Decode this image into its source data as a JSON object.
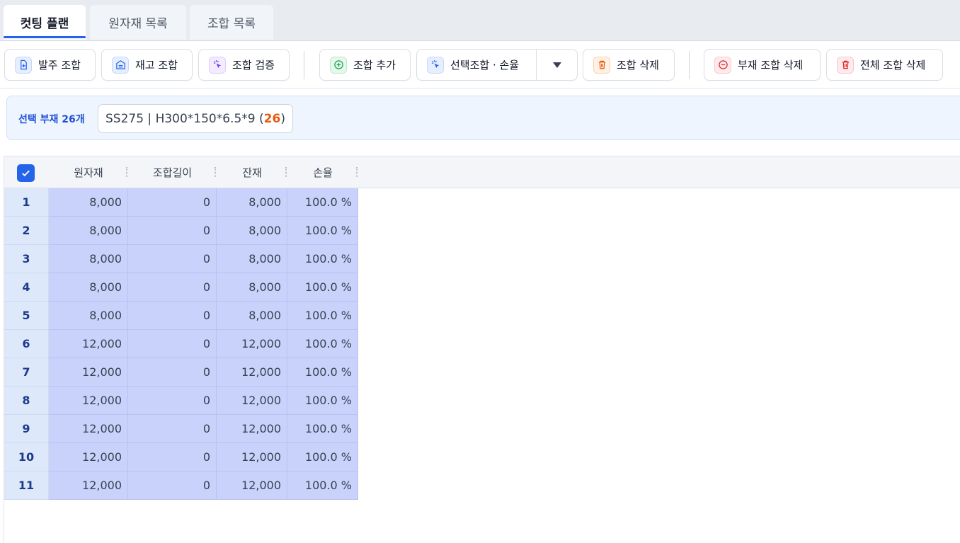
{
  "tabs": [
    {
      "label": "컷팅 플랜",
      "active": true
    },
    {
      "label": "원자재 목록",
      "active": false
    },
    {
      "label": "조합 목록",
      "active": false
    }
  ],
  "toolbar": {
    "order_combo": "발주 조합",
    "stock_combo": "재고 조합",
    "verify_combo": "조합 검증",
    "add_combo": "조합 추가",
    "selected_combo_loss": "선택조합 · 손율",
    "delete_combo": "조합 삭제",
    "delete_member_combo": "부재 조합 삭제",
    "delete_all_combo": "전체 조합 삭제"
  },
  "selection": {
    "label": "선택 부재 26개",
    "chip_spec": "SS275 | H300*150*6.5*9 (",
    "chip_count": "26",
    "chip_close": ")"
  },
  "grid": {
    "header_checked": true,
    "columns": [
      "원자재",
      "조합길이",
      "잔재",
      "손율"
    ],
    "rows": [
      [
        "1",
        "8,000",
        "0",
        "8,000",
        "100.0 %"
      ],
      [
        "2",
        "8,000",
        "0",
        "8,000",
        "100.0 %"
      ],
      [
        "3",
        "8,000",
        "0",
        "8,000",
        "100.0 %"
      ],
      [
        "4",
        "8,000",
        "0",
        "8,000",
        "100.0 %"
      ],
      [
        "5",
        "8,000",
        "0",
        "8,000",
        "100.0 %"
      ],
      [
        "6",
        "12,000",
        "0",
        "12,000",
        "100.0 %"
      ],
      [
        "7",
        "12,000",
        "0",
        "12,000",
        "100.0 %"
      ],
      [
        "8",
        "12,000",
        "0",
        "12,000",
        "100.0 %"
      ],
      [
        "9",
        "12,000",
        "0",
        "12,000",
        "100.0 %"
      ],
      [
        "10",
        "12,000",
        "0",
        "12,000",
        "100.0 %"
      ],
      [
        "11",
        "12,000",
        "0",
        "12,000",
        "100.0 %"
      ]
    ]
  },
  "colors": {
    "accent": "#2563eb",
    "selected_cell": "#c8d2fb",
    "count_highlight": "#ea580c"
  }
}
